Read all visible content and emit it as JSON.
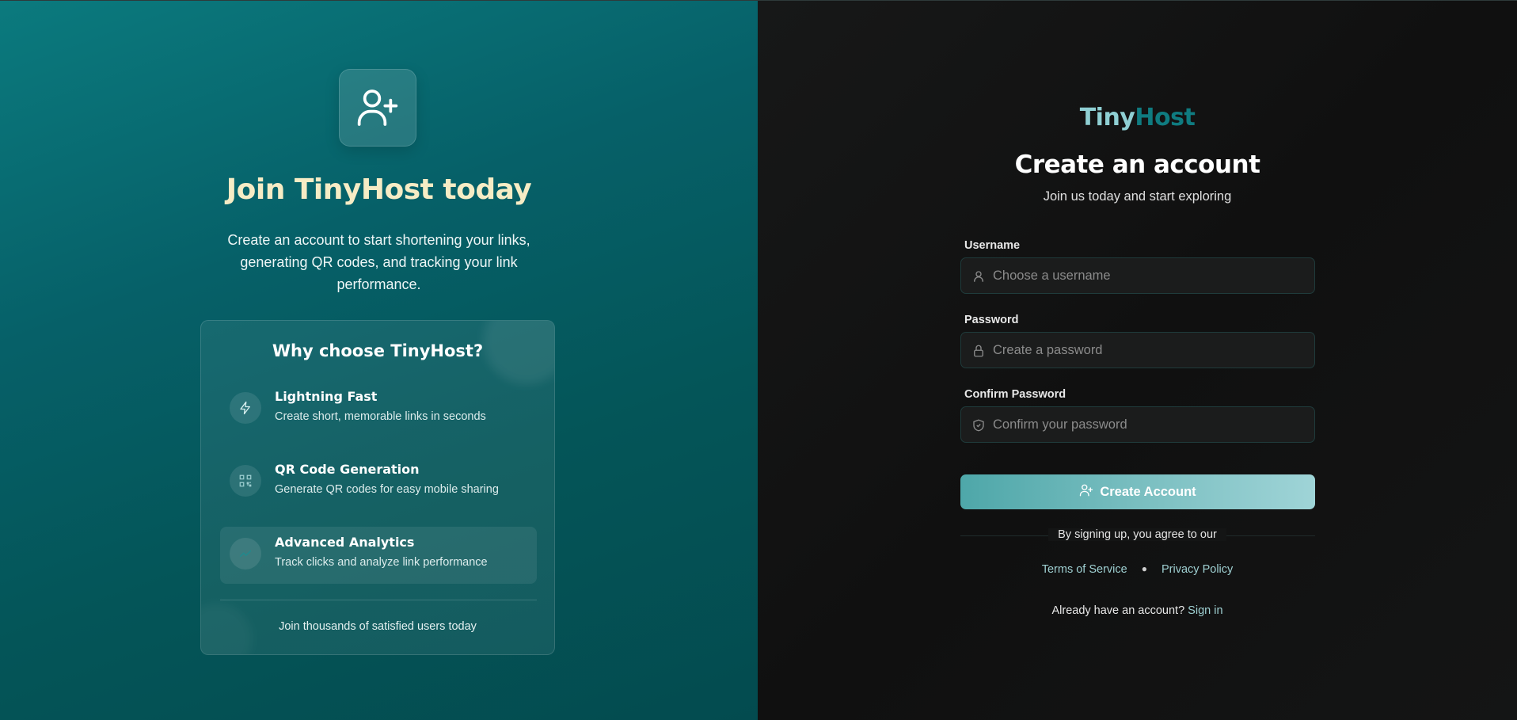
{
  "hero": {
    "icon": "user-plus-icon",
    "title": "Join TinyHost today",
    "description": "Create an account to start shortening your links, generating QR codes, and tracking your link performance."
  },
  "why": {
    "title": "Why choose TinyHost?",
    "features": [
      {
        "name": "Lightning Fast",
        "desc": "Create short, memorable links in seconds",
        "icon": "lightning-icon"
      },
      {
        "name": "QR Code Generation",
        "desc": "Generate QR codes for easy mobile sharing",
        "icon": "qr-code-icon"
      },
      {
        "name": "Advanced Analytics",
        "desc": "Track clicks and analyze link performance",
        "icon": "analytics-icon"
      }
    ],
    "footer": "Join thousands of satisfied users today"
  },
  "brand": {
    "part1": "Tiny",
    "part2": "Host"
  },
  "form": {
    "title": "Create an account",
    "subtitle": "Join us today and start exploring",
    "username": {
      "label": "Username",
      "placeholder": "Choose a username",
      "icon": "user-icon"
    },
    "password": {
      "label": "Password",
      "placeholder": "Create a password",
      "icon": "lock-icon"
    },
    "confirm": {
      "label": "Confirm Password",
      "placeholder": "Confirm your password",
      "icon": "shield-icon"
    },
    "submit_label": "Create Account",
    "terms_intro": "By signing up, you agree to our",
    "terms_link": "Terms of Service",
    "privacy_link": "Privacy Policy",
    "signin_prompt": "Already have an account?",
    "signin_link": "Sign in"
  },
  "colors": {
    "left_bg": "#066068",
    "hero_title": "#f6ecc5",
    "brand_light": "#8fcfd3",
    "brand_dark": "#0f7b80",
    "cta_gradient_start": "#4ea7a9",
    "cta_gradient_end": "#9fd4d7",
    "link": "#9fd0d2"
  }
}
